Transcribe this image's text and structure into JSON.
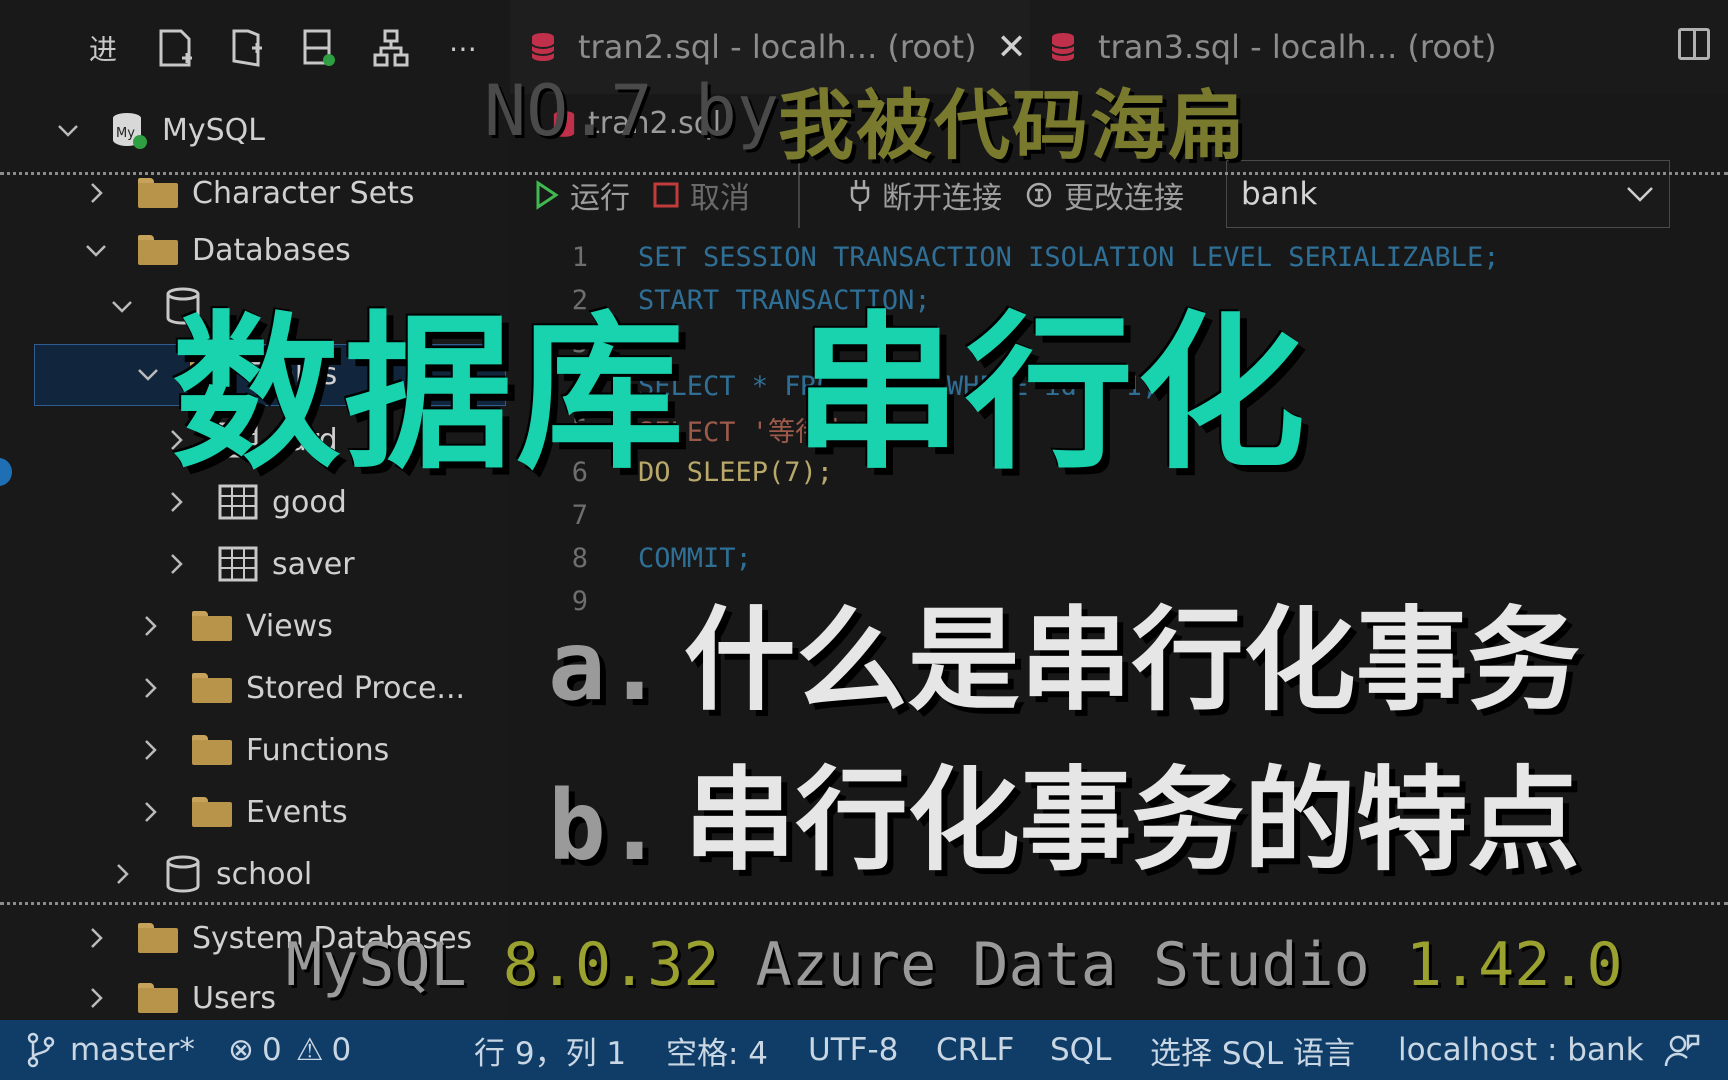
{
  "sidebar": {
    "toolbar_first_glyph": "进",
    "tree": {
      "connection": "MySQL",
      "character_sets": "Character Sets",
      "databases": "Databases",
      "tables": "Tables",
      "table_card": "card",
      "table_good": "good",
      "table_saver": "saver",
      "views": "Views",
      "stored_procedures": "Stored Proce...",
      "functions": "Functions",
      "events": "Events",
      "school": "school",
      "system_databases": "System Databases",
      "users": "Users"
    }
  },
  "tabs": [
    {
      "label": "tran2.sql - localh... (root)",
      "active": true
    },
    {
      "label": "tran3.sql - localh... (root)",
      "active": false
    }
  ],
  "breadcrumb": "tran2.sql",
  "query_toolbar": {
    "run": "运行",
    "cancel": "取消",
    "disconnect": "断开连接",
    "change_connection": "更改连接",
    "database": "bank"
  },
  "code_lines": [
    {
      "n": "1",
      "text": "SET SESSION TRANSACTION ISOLATION LEVEL SERIALIZABLE;"
    },
    {
      "n": "2",
      "text": "START TRANSACTION;"
    },
    {
      "n": "3",
      "text": ""
    },
    {
      "n": "4",
      "text": "SELECT * FROM good WHERE id = 1;"
    },
    {
      "n": "5",
      "text": "SELECT '等待中';"
    },
    {
      "n": "6",
      "text": "DO SLEEP(7);"
    },
    {
      "n": "7",
      "text": ""
    },
    {
      "n": "8",
      "text": "COMMIT;"
    },
    {
      "n": "9",
      "text": ""
    }
  ],
  "overlay": {
    "episode": "NO.7 by",
    "author": "我被代码海扁",
    "title": "数据库 串行化",
    "item_a_marker": "a.",
    "item_a": "什么是串行化事务",
    "item_b_marker": "b.",
    "item_b": "串行化事务的特点",
    "version_a": "MySQL",
    "version_a_num": "8.0.32",
    "version_b": "Azure Data Studio",
    "version_b_num": "1.42.0"
  },
  "status": {
    "branch": "master*",
    "errors": "0",
    "warnings": "0",
    "position": "行 9，列 1",
    "spaces": "空格: 4",
    "encoding": "UTF-8",
    "eol": "CRLF",
    "language": "SQL",
    "select_language": "选择 SQL 语言",
    "connection": "localhost : bank"
  },
  "colors": {
    "title_accent": "#19d2ae",
    "author_accent": "#7a7a2e",
    "statusbar": "#0f3d67",
    "connected": "#2ea043"
  }
}
